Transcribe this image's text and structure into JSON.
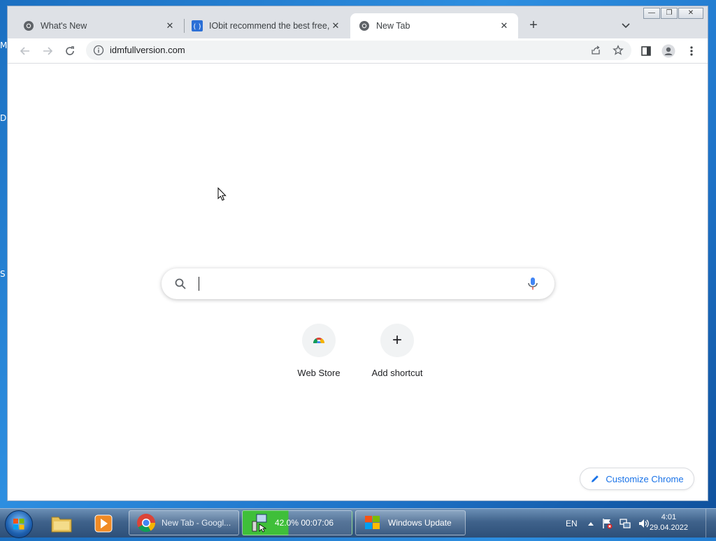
{
  "desktop": {
    "edge_glyphs": [
      "M",
      "D",
      "S"
    ]
  },
  "window_controls": {
    "minimize": "—",
    "restore": "❐",
    "close": "✕"
  },
  "tabs": [
    {
      "title": "What's New",
      "icon": "chrome-icon"
    },
    {
      "title": "IObit recommend the best free, t",
      "icon": "iobit-icon"
    },
    {
      "title": "New Tab",
      "icon": "chrome-icon",
      "active": true
    }
  ],
  "tab_close_glyph": "✕",
  "new_tab_glyph": "+",
  "tab_search_glyph": "⌄",
  "toolbar": {
    "url": "idmfullversion.com"
  },
  "ntp": {
    "search_placeholder": "",
    "shortcuts": [
      {
        "label": "Web Store",
        "icon": "chrome-web-store-icon"
      },
      {
        "label": "Add shortcut",
        "icon": "plus-icon",
        "glyph": "+"
      }
    ],
    "customize_label": "Customize Chrome"
  },
  "taskbar": {
    "tasks": [
      {
        "label": "New Tab - Googl..."
      },
      {
        "label": "42.0%   00:07:06",
        "progress_percent": 42
      },
      {
        "label": "Windows Update"
      }
    ],
    "language": "EN",
    "time": "4:01",
    "date": "29.04.2022"
  },
  "colors": {
    "accent": "#1a73e8",
    "tabstrip": "#dee1e6",
    "taskbar": "#3f628b"
  }
}
